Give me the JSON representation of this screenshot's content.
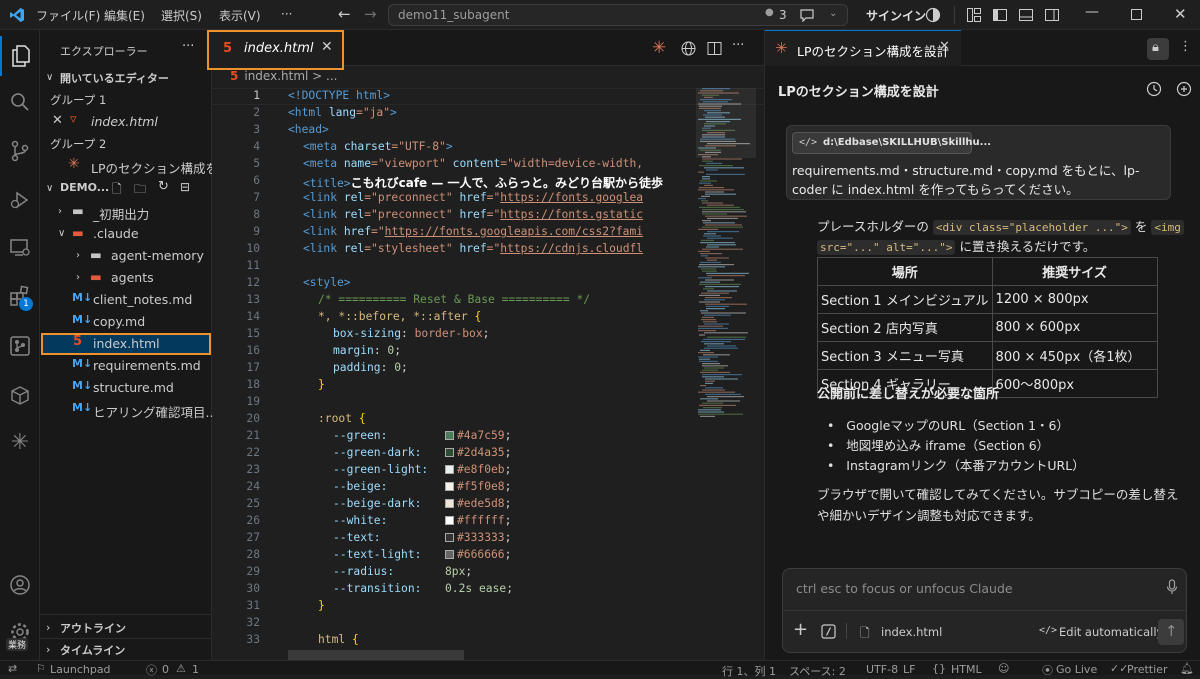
{
  "titlebar": {
    "menus": [
      "ファイル(F)",
      "編集(E)",
      "選択(S)",
      "表示(V)",
      "···"
    ],
    "search": "demo11_subagent",
    "badge_count": "3",
    "signin": "サインイン"
  },
  "activity": {
    "extensions_badge": "1",
    "manage_badge": "業務"
  },
  "sidebar": {
    "title": "エクスプローラー",
    "open_editors": "開いているエディター",
    "group1": "グループ 1",
    "group1_file": "index.html",
    "group2": "グループ 2",
    "group2_file": "LPのセクション構成を...",
    "workspace": "DEMO...",
    "tree": [
      "_初期出力",
      ".claude",
      "agent-memory",
      "agents",
      "client_notes.md",
      "copy.md",
      "index.html",
      "requirements.md",
      "structure.md",
      "ヒアリング確認項目..."
    ],
    "outline": "アウトライン",
    "timeline": "タイムライン"
  },
  "editor": {
    "tab": "index.html",
    "breadcrumb_file": "index.html",
    "breadcrumb_rest": "> ...",
    "line_numbers": [
      "1",
      "2",
      "3",
      "4",
      "5",
      "6",
      "7",
      "8",
      "9",
      "10",
      "11",
      "12",
      "13",
      "14",
      "15",
      "16",
      "17",
      "18",
      "19",
      "20",
      "21",
      "22",
      "23",
      "24",
      "25",
      "26",
      "27",
      "28",
      "29",
      "30",
      "31",
      "32",
      "33"
    ],
    "code": {
      "l1": "<!DOCTYPE html>",
      "l2a": "<html ",
      "l2b": "lang",
      "l2c": "=\"ja\"",
      "l2d": ">",
      "l3": "<head>",
      "l4a": "<meta ",
      "l4b": "charset",
      "l4c": "=\"UTF-8\"",
      "l4d": ">",
      "l5a": "<meta ",
      "l5b": "name",
      "l5c": "=\"viewport\" ",
      "l5d": "content",
      "l5e": "=\"width=device-width,",
      "l6a": "<title>",
      "l6b": "こもれびcafe — 一人で、ふらっと。みどり台駅から徒歩",
      "l7a": "<link ",
      "l7b": "rel",
      "l7c": "=\"preconnect\" ",
      "l7d": "href",
      "l7e": "=\"",
      "l7f": "https://fonts.googlea",
      "l8a": "<link ",
      "l8b": "rel",
      "l8c": "=\"preconnect\" ",
      "l8d": "href",
      "l8e": "=\"",
      "l8f": "https://fonts.gstatic",
      "l9a": "<link ",
      "l9b": "href",
      "l9c": "=\"",
      "l9d": "https://fonts.googleapis.com/css2?fami",
      "l10a": "<link ",
      "l10b": "rel",
      "l10c": "=\"stylesheet\" ",
      "l10d": "href",
      "l10e": "=\"",
      "l10f": "https://cdnjs.cloudfl",
      "l12": "<style>",
      "l13": "/* ========== Reset & Base ========== */",
      "l14a": "*, *::before, *::after ",
      "l14b": "{",
      "l15a": "box-sizing",
      "l15b": ": ",
      "l15c": "border-box",
      "l15d": ";",
      "l16a": "margin",
      "l16b": ": ",
      "l16c": "0",
      "l16d": ";",
      "l17a": "padding",
      "l17b": ": ",
      "l17c": "0",
      "l17d": ";",
      "l18": "}",
      "l20a": ":root ",
      "l20b": "{",
      "vars": [
        {
          "name": "--green:",
          "value": "#4a7c59",
          "color": "#4a7c59"
        },
        {
          "name": "--green-dark:",
          "value": "#2d4a35",
          "color": "#2d4a35"
        },
        {
          "name": "--green-light:",
          "value": "#e8f0eb",
          "color": "#e8f0eb"
        },
        {
          "name": "--beige:",
          "value": "#f5f0e8",
          "color": "#f5f0e8"
        },
        {
          "name": "--beige-dark:",
          "value": "#ede5d8",
          "color": "#ede5d8"
        },
        {
          "name": "--white:",
          "value": "#ffffff",
          "color": "#ffffff"
        },
        {
          "name": "--text:",
          "value": "#333333",
          "color": "#333333"
        },
        {
          "name": "--text-light:",
          "value": "#666666",
          "color": "#666666"
        }
      ],
      "l29a": "--radius:",
      "l29b": "8px",
      "l30a": "--transition:",
      "l30b": "0.2s ease",
      "l31": "}",
      "l33a": "html ",
      "l33b": "{"
    }
  },
  "chat": {
    "tab": "LPのセクション構成を設計",
    "header": "LPのセクション構成を設計",
    "path_chip": "d:\\Edbase\\SKILLHUB\\Skillhu...",
    "user_message": "requirements.md・structure.md・copy.md をもとに、lp-coder に index.html を作ってもらってください。",
    "p1a": "プレースホルダーの",
    "p1_code1": "<div class=\"placeholder ...\">",
    "p1b": "を",
    "p1_code2a": "<img",
    "p1_code2b": "src=\"...\" alt=\"...\">",
    "p1c": "に置き換えるだけです。",
    "table_headers": [
      "場所",
      "推奨サイズ"
    ],
    "table_rows": [
      [
        "Section 1 メインビジュアル",
        "1200 × 800px"
      ],
      [
        "Section 2 店内写真",
        "800 × 600px"
      ],
      [
        "Section 3 メニュー写真",
        "800 × 450px（各1枚）"
      ],
      [
        "Section 4 ギャラリー",
        "600〜800px"
      ]
    ],
    "heading": "公開前に差し替えが必要な箇所",
    "bullets": [
      "GoogleマップのURL（Section 1・6）",
      "地図埋め込み iframe（Section 6）",
      "Instagramリンク（本番アカウントURL）"
    ],
    "closing": "ブラウザで開いて確認してみてください。サブコピーの差し替えや細かいデザイン調整も対応できます。",
    "input_placeholder": "ctrl esc to focus or unfocus Claude",
    "file_chip": "index.html",
    "mode": "Edit automatically"
  },
  "status": {
    "launchpad": "Launchpad",
    "errors": "0",
    "warnings": "1",
    "position": "行 1、列 1",
    "spaces": "スペース: 2",
    "encoding": "UTF-8",
    "eol": "LF",
    "language": "HTML",
    "golive": "Go Live",
    "prettier": "Prettier"
  }
}
